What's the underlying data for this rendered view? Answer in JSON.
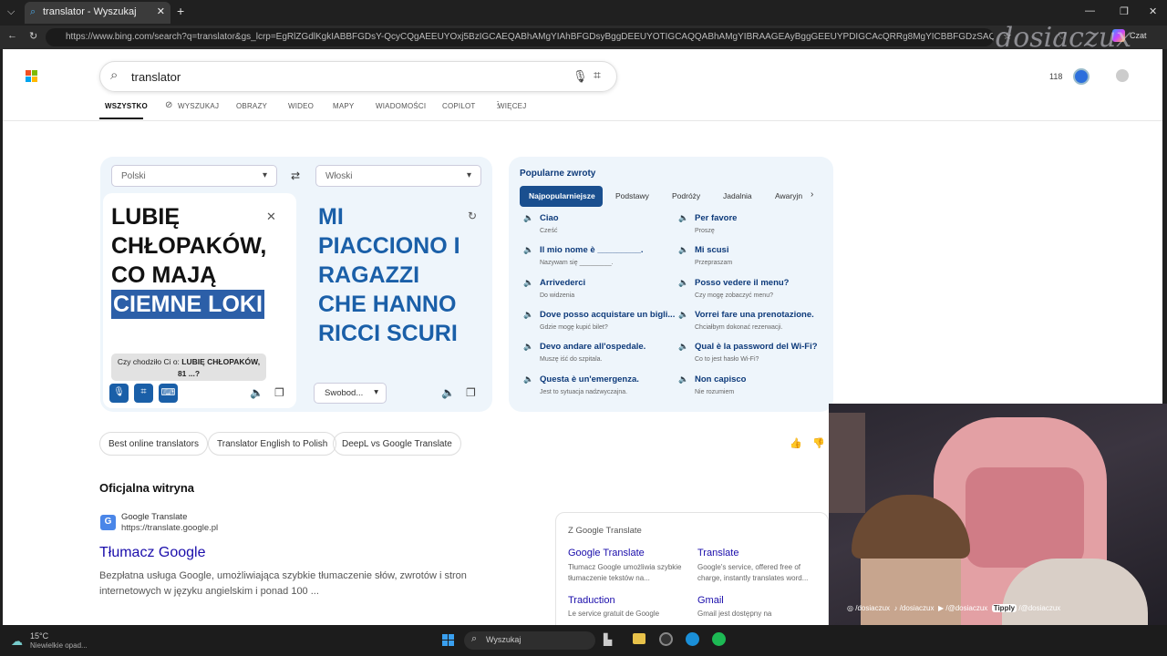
{
  "browser": {
    "tab_title": "translator - Wyszukaj",
    "url": "https://www.bing.com/search?q=translator&gs_lcrp=EgRlZGdlKgkIABBFGDsY-QcyCQgAEEUYOxj5BzIGCAEQABhAMgYIAhBFGDsyBggDEEUYOTIGCAQQABhAMgYIBRAAGEAyBggGEEUYPDIGCAcQRRg8MgYICBBFGDzSAQgxNzgyajBqN6gCALACAA&...",
    "czat": "Czat",
    "overlay_name": "dosiaczux"
  },
  "bing": {
    "query": "translator",
    "rewards": "118",
    "tabs": [
      "WSZYSTKO",
      "WYSZUKAJ",
      "OBRAZY",
      "WIDEO",
      "MAPY",
      "WIADOMOŚCI",
      "COPILOT",
      "WIĘCEJ"
    ]
  },
  "translator": {
    "source_lang": "Polski",
    "target_lang": "Włoski",
    "source_text": "LUBIĘ\nCHŁOPAKÓW,\nCO MAJĄ",
    "source_highlight": "CIEMNE LOKI",
    "target_text": "MI\nPIACCIONO I\nRAGAZZI\nCHE HANNO\nRICCI SCURI",
    "suggest_prefix": "Czy chodziło Ci o:",
    "suggest_bold": "LUBIĘ CHŁOPAKÓW,",
    "suggest_rest": "81 ...?",
    "style_btn": "Swobod..."
  },
  "phrases": {
    "title": "Popularne zwroty",
    "tabs": [
      "Najpopularniejsze",
      "Podstawy",
      "Podróży",
      "Jadalnia",
      "Awaryjn"
    ],
    "items": [
      {
        "it": "Ciao",
        "pl": "Cześć"
      },
      {
        "it": "Per favore",
        "pl": "Proszę"
      },
      {
        "it": "Il mio nome è _________.",
        "pl": "Nazywam się _________."
      },
      {
        "it": "Mi scusi",
        "pl": "Przepraszam"
      },
      {
        "it": "Arrivederci",
        "pl": "Do widzenia"
      },
      {
        "it": "Posso vedere il menu?",
        "pl": "Czy mogę zobaczyć menu?"
      },
      {
        "it": "Dove posso acquistare un bigli...",
        "pl": "Gdzie mogę kupić bilet?"
      },
      {
        "it": "Vorrei fare una prenotazione.",
        "pl": "Chciałbym dokonać rezerwacji."
      },
      {
        "it": "Devo andare all'ospedale.",
        "pl": "Muszę iść do szpitala."
      },
      {
        "it": "Qual è la password del Wi-Fi?",
        "pl": "Co to jest hasło Wi-Fi?"
      },
      {
        "it": "Questa è un'emergenza.",
        "pl": "Jest to sytuacja nadzwyczajna."
      },
      {
        "it": "Non capisco",
        "pl": "Nie rozumiem"
      }
    ]
  },
  "chips": [
    "Best online translators",
    "Translator English to Polish",
    "DeepL vs Google Translate"
  ],
  "result": {
    "section": "Oficjalna witryna",
    "site": "Google Translate",
    "url": "https://translate.google.pl",
    "title": "Tłumacz Google",
    "desc1": "Bezpłatna usługa Google, umożliwiająca szybkie tłumaczenie słów, zwrotów i stron",
    "desc2": "internetowych w języku angielskim i ponad 100 ..."
  },
  "sidepanel": {
    "header": "Z Google Translate",
    "links": [
      {
        "t": "Google Translate",
        "d": "Tłumacz Google umożliwia szybkie tłumaczenie tekstów na..."
      },
      {
        "t": "Translate",
        "d": "Google's service, offered free of charge, instantly translates word..."
      },
      {
        "t": "Traduction",
        "d": "Le service gratuit de Google"
      },
      {
        "t": "Gmail",
        "d": "Gmail jest dostępny na"
      }
    ]
  },
  "social": [
    "/dosiaczux",
    "/dosiaczux",
    "/@dosiaczux",
    "/@dosiaczux"
  ],
  "tippy": "Tipply",
  "taskbar": {
    "temp": "15°C",
    "weather": "Niewielkie opad...",
    "search": "Wyszukaj"
  }
}
